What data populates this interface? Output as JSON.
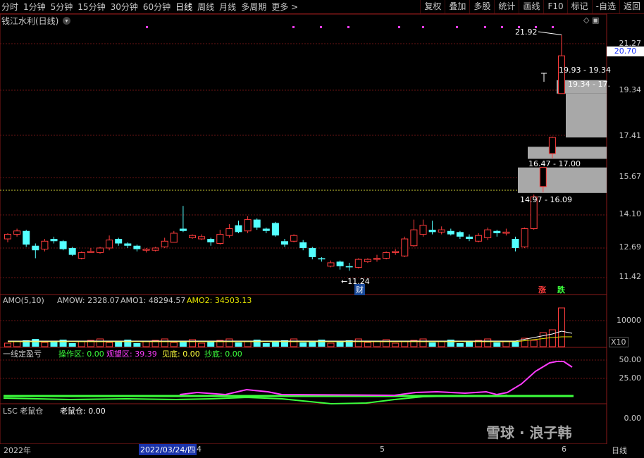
{
  "toolbar": {
    "tabs": [
      "分时",
      "1分钟",
      "5分钟",
      "15分钟",
      "30分钟",
      "60分钟",
      "日线",
      "周线",
      "月线",
      "多周期",
      "更多 >"
    ],
    "active_tab": "日线",
    "tools": [
      "复权",
      "叠加",
      "多股",
      "统计",
      "画线",
      "F10",
      "标记",
      "-自选",
      "返回"
    ]
  },
  "stock": {
    "title": "钱江水利(日线)"
  },
  "price_axis": {
    "ticks": [
      "21.27",
      "19.34",
      "17.41",
      "15.67",
      "14.10",
      "12.69",
      "11.42"
    ],
    "current": "20.70"
  },
  "annotations": {
    "high": "21.92",
    "low": "11.24",
    "gap1": "19.93 - 19.34",
    "gap2": "19.34 - 17.",
    "gap3": "16.47 - 17.00",
    "gap4": "14.97 - 16.09",
    "cai_badge": "财",
    "zhang": "涨",
    "die": "跌"
  },
  "amo": {
    "title": "AMO(5,10)",
    "amow": "AMOW: 2328.07",
    "amo1": "AMO1: 48294.57",
    "amo2": "AMO2: 34503.13",
    "axis_top": "10000",
    "axis_unit": "X10"
  },
  "indicator": {
    "title": "一线定盈亏",
    "op": "操作区: 0.00",
    "watch": "观望区: 39.39",
    "jiandi": "见底: 0.00",
    "chaodi": "抄底: 0.00",
    "axis": [
      "50.00",
      "25.00"
    ]
  },
  "lsc": {
    "title": "LSC 老鼠仓",
    "value": "老鼠仓: 0.00",
    "axis": "0.00"
  },
  "dates": {
    "year": "2022年",
    "selected": "2022/03/24/四",
    "m4": "4",
    "m5": "5",
    "m6": "6",
    "period": "日线"
  },
  "watermark": "雪球 · 浪子韩",
  "colors": {
    "up": "#ff3c3c",
    "down": "#54ffff",
    "grid": "#6a1414",
    "ma_pink": "#ff3cff",
    "ma_green": "#3cff3c"
  },
  "chart_data": {
    "type": "candlestick",
    "price_range": [
      11.0,
      22.4
    ],
    "candles": [
      [
        12.95,
        13.15,
        12.8,
        13.2
      ],
      [
        13.15,
        13.3,
        13.05,
        13.4
      ],
      [
        13.3,
        12.7,
        12.6,
        13.35
      ],
      [
        12.65,
        12.45,
        12.1,
        12.75
      ],
      [
        12.5,
        12.85,
        12.4,
        12.95
      ],
      [
        12.95,
        12.85,
        12.75,
        13.05
      ],
      [
        12.85,
        12.5,
        12.45,
        12.9
      ],
      [
        12.55,
        12.25,
        12.2,
        12.6
      ],
      [
        12.1,
        12.35,
        12.05,
        12.4
      ],
      [
        12.4,
        12.4,
        12.35,
        12.55
      ],
      [
        12.35,
        12.55,
        12.3,
        12.6
      ],
      [
        12.55,
        12.9,
        12.45,
        13.1
      ],
      [
        12.95,
        12.75,
        12.65,
        13.0
      ],
      [
        12.75,
        12.65,
        12.55,
        12.8
      ],
      [
        12.65,
        12.5,
        12.4,
        12.7
      ],
      [
        12.45,
        12.5,
        12.35,
        12.55
      ],
      [
        12.45,
        12.55,
        12.4,
        12.6
      ],
      [
        12.6,
        12.85,
        12.55,
        13.0
      ],
      [
        12.8,
        13.2,
        12.8,
        13.3
      ],
      [
        13.4,
        13.3,
        13.25,
        14.4
      ],
      [
        13.0,
        13.1,
        12.95,
        13.15
      ],
      [
        12.95,
        13.05,
        12.9,
        13.15
      ],
      [
        12.95,
        12.8,
        12.65,
        13.0
      ],
      [
        12.75,
        13.15,
        12.7,
        13.35
      ],
      [
        13.1,
        13.4,
        13.0,
        13.6
      ],
      [
        13.55,
        13.25,
        13.2,
        13.75
      ],
      [
        13.3,
        13.8,
        13.2,
        13.95
      ],
      [
        13.8,
        13.45,
        13.35,
        13.85
      ],
      [
        13.4,
        13.3,
        13.2,
        13.45
      ],
      [
        13.65,
        13.1,
        13.05,
        13.7
      ],
      [
        12.85,
        12.7,
        12.6,
        12.95
      ],
      [
        12.85,
        13.1,
        12.8,
        13.15
      ],
      [
        12.8,
        12.55,
        12.45,
        12.9
      ],
      [
        12.55,
        12.15,
        12.05,
        12.6
      ],
      [
        12.1,
        12.05,
        11.95,
        12.15
      ],
      [
        11.75,
        11.9,
        11.7,
        12.0
      ],
      [
        11.95,
        11.75,
        11.6,
        12.0
      ],
      [
        11.75,
        11.7,
        11.55,
        11.9
      ],
      [
        11.7,
        12.05,
        11.65,
        12.1
      ],
      [
        11.95,
        12.05,
        11.9,
        12.1
      ],
      [
        12.05,
        12.1,
        11.95,
        12.25
      ],
      [
        12.1,
        12.35,
        12.05,
        12.4
      ],
      [
        12.35,
        12.4,
        12.25,
        12.5
      ],
      [
        12.2,
        12.95,
        12.15,
        13.05
      ],
      [
        12.65,
        13.35,
        12.6,
        13.8
      ],
      [
        13.15,
        13.55,
        13.05,
        13.8
      ],
      [
        13.35,
        13.25,
        13.15,
        13.75
      ],
      [
        13.25,
        13.35,
        13.15,
        13.5
      ],
      [
        13.3,
        13.15,
        13.1,
        13.4
      ],
      [
        13.25,
        13.05,
        12.95,
        13.3
      ],
      [
        13.05,
        12.95,
        12.85,
        13.15
      ],
      [
        12.85,
        13.1,
        12.8,
        13.2
      ],
      [
        13.0,
        13.35,
        12.9,
        13.45
      ],
      [
        13.3,
        13.2,
        13.05,
        13.35
      ],
      [
        13.2,
        13.25,
        13.1,
        13.4
      ],
      [
        12.95,
        12.55,
        12.4,
        13.05
      ],
      [
        12.6,
        13.4,
        12.55,
        13.45
      ],
      [
        13.4,
        14.8,
        13.35,
        14.9
      ],
      [
        15.25,
        16.09,
        15.0,
        16.1
      ],
      [
        16.7,
        17.41,
        16.5,
        17.45
      ],
      [
        19.34,
        21.0,
        19.34,
        21.92
      ]
    ]
  }
}
